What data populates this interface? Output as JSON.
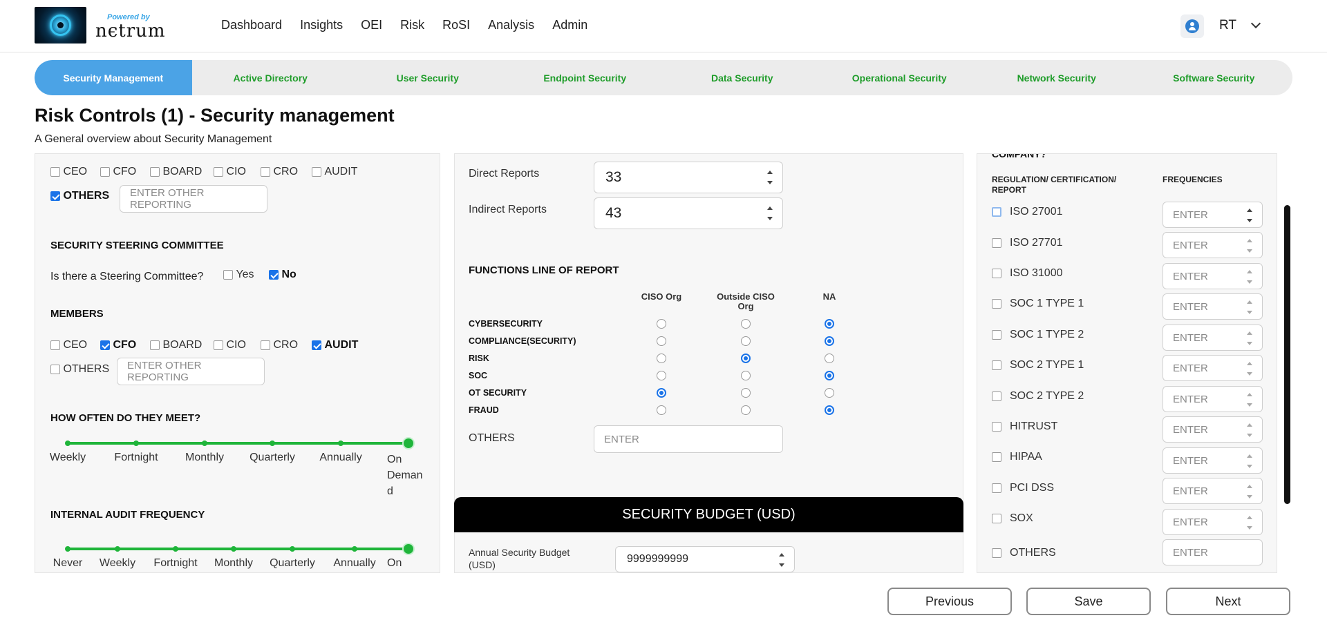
{
  "header": {
    "powered_by": "Powered by",
    "brand": "nєtrum",
    "nav": [
      "Dashboard",
      "Insights",
      "OEI",
      "Risk",
      "RoSI",
      "Analysis",
      "Admin"
    ],
    "user_initials": "RT"
  },
  "tabs": [
    "Security Management",
    "Active Directory",
    "User Security",
    "Endpoint Security",
    "Data Security",
    "Operational Security",
    "Network Security",
    "Software Security"
  ],
  "page": {
    "title": "Risk Controls (1) - Security management",
    "subtitle": "A General overview about Security Management"
  },
  "reporting": {
    "options": [
      "CEO",
      "CFO",
      "BOARD",
      "CIO",
      "CRO",
      "AUDIT"
    ],
    "checked": [
      false,
      false,
      false,
      false,
      false,
      false
    ],
    "others_label": "OTHERS",
    "others_checked": true,
    "others_placeholder": "ENTER OTHER REPORTING"
  },
  "steering": {
    "heading": "SECURITY STEERING COMMITTEE",
    "question": "Is there a Steering Committee?",
    "yes_label": "Yes",
    "no_label": "No",
    "yes_checked": false,
    "no_checked": true
  },
  "members": {
    "heading": "MEMBERS",
    "options": [
      "CEO",
      "CFO",
      "BOARD",
      "CIO",
      "CRO",
      "AUDIT"
    ],
    "checked": [
      false,
      true,
      false,
      false,
      false,
      true
    ],
    "others_label": "OTHERS",
    "others_checked": false,
    "others_placeholder": "ENTER OTHER REPORTING"
  },
  "meet_frequency": {
    "heading": "HOW OFTEN DO THEY MEET?",
    "labels": [
      "Weekly",
      "Fortnight",
      "Monthly",
      "Quarterly",
      "Annually",
      "On Deman d"
    ],
    "selected": "On Deman d"
  },
  "audit_frequency": {
    "heading": "INTERNAL AUDIT FREQUENCY",
    "labels": [
      "Never",
      "Weekly",
      "Fortnight",
      "Monthly",
      "Quarterly",
      "Annually",
      "On"
    ],
    "selected": "On"
  },
  "reports": {
    "direct_label": "Direct Reports",
    "direct_value": "33",
    "indirect_label": "Indirect Reports",
    "indirect_value": "43"
  },
  "functions": {
    "heading": "FUNCTIONS LINE OF REPORT",
    "columns": [
      "CISO Org",
      "Outside CISO Org",
      "NA"
    ],
    "rows": [
      {
        "label": "CYBERSECURITY",
        "selected": "NA"
      },
      {
        "label": "COMPLIANCE(SECURITY)",
        "selected": "NA"
      },
      {
        "label": "RISK",
        "selected": "Outside CISO Org"
      },
      {
        "label": "SOC",
        "selected": "NA"
      },
      {
        "label": "OT SECURITY",
        "selected": "CISO Org"
      },
      {
        "label": "FRAUD",
        "selected": "NA"
      }
    ],
    "others_label": "OTHERS",
    "others_placeholder": "ENTER"
  },
  "budget": {
    "heading": "SECURITY BUDGET (USD)",
    "annual_label": "Annual Security Budget (USD)",
    "annual_value": "9999999999"
  },
  "regulations": {
    "heading_partial": "COMPANY?",
    "col_reg": "REGULATION/ CERTIFICATION/ REPORT",
    "col_freq": "FREQUENCIES",
    "items": [
      "ISO 27001",
      "ISO 27701",
      "ISO 31000",
      "SOC 1 TYPE 1",
      "SOC 1 TYPE 2",
      "SOC 2 TYPE 1",
      "SOC 2 TYPE 2",
      "HITRUST",
      "HIPAA",
      "PCI DSS",
      "SOX",
      "OTHERS"
    ],
    "placeholder": "ENTER"
  },
  "footer": {
    "previous": "Previous",
    "save": "Save",
    "next": "Next"
  },
  "colors": {
    "accent_blue": "#4ba3e6",
    "tab_green": "#1f9d2a",
    "slider_green": "#1fb53a",
    "check_blue": "#1a73e8"
  }
}
